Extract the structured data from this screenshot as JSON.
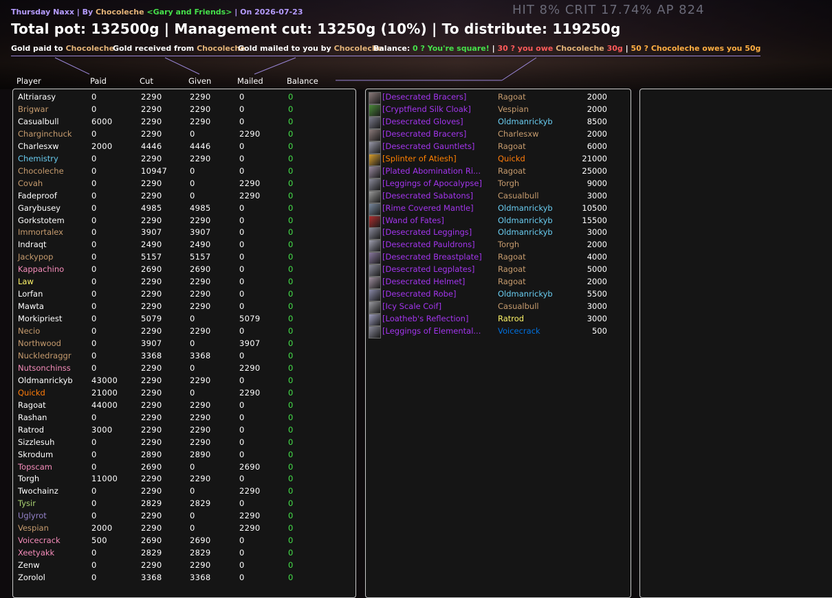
{
  "header": {
    "subtitle": {
      "event": "Thursday Naxx",
      "sep1": " | By ",
      "author": "Chocoleche",
      "guild": "<Gary and Friends>",
      "sep2": " | On ",
      "date": "2026-07-23"
    },
    "title": "Total pot: 132500g | Management cut: 13250g (10%) | To distribute: 119250g",
    "ghost_hud": "HIT 8% CRIT 17.74%  AP 824"
  },
  "legend": {
    "paid": {
      "label": "Gold paid to ",
      "who": "Chocoleche"
    },
    "received": {
      "label": "Gold received from ",
      "who": "Chocoleche"
    },
    "mailed": {
      "label": "Gold mailed to you by ",
      "who": "Chocoleche"
    },
    "balance": {
      "label": "Balance: ",
      "square": "0 ? You're square!",
      "sep": "  |  ",
      "owe_a": "30 ? you owe ",
      "owe_who": "Chocoleche",
      "owe_b": " 30g",
      "owes_a": "50 ? ",
      "owes_who": "Chocoleche",
      "owes_b": " owes you 50g"
    }
  },
  "columns": {
    "player": "Player",
    "paid": "Paid",
    "cut": "Cut",
    "given": "Given",
    "mailed": "Mailed",
    "balance": "Balance"
  },
  "colors": {
    "warrior": "#c79c6e",
    "paladin": "#f58cba",
    "mage": "#69ccf0",
    "white": "#ffffff",
    "warlock": "#9482c9",
    "hunter": "#abd473",
    "rogue": "#fff569",
    "druid": "#ff7d0a",
    "shaman": "#0070de",
    "epic": "#a335ee",
    "legendary": "#ff8000",
    "balance_zero": "#45e04a"
  },
  "players": [
    {
      "name": "Altriarasy",
      "color": "#ffffff",
      "paid": "0",
      "cut": "2290",
      "given": "2290",
      "mailed": "0",
      "balance": "0"
    },
    {
      "name": "Brigwar",
      "color": "#c79c6e",
      "paid": "0",
      "cut": "2290",
      "given": "2290",
      "mailed": "0",
      "balance": "0"
    },
    {
      "name": "Casualbull",
      "color": "#ffffff",
      "paid": "6000",
      "cut": "2290",
      "given": "2290",
      "mailed": "0",
      "balance": "0"
    },
    {
      "name": "Charginchuck",
      "color": "#c79c6e",
      "paid": "0",
      "cut": "2290",
      "given": "0",
      "mailed": "2290",
      "balance": "0"
    },
    {
      "name": "Charlesxw",
      "color": "#ffffff",
      "paid": "2000",
      "cut": "4446",
      "given": "4446",
      "mailed": "0",
      "balance": "0"
    },
    {
      "name": "Chemistry",
      "color": "#69ccf0",
      "paid": "0",
      "cut": "2290",
      "given": "2290",
      "mailed": "0",
      "balance": "0"
    },
    {
      "name": "Chocoleche",
      "color": "#c79c6e",
      "paid": "0",
      "cut": "10947",
      "given": "0",
      "mailed": "0",
      "balance": "0"
    },
    {
      "name": "Covah",
      "color": "#c79c6e",
      "paid": "0",
      "cut": "2290",
      "given": "0",
      "mailed": "2290",
      "balance": "0"
    },
    {
      "name": "Fadeproof",
      "color": "#ffffff",
      "paid": "0",
      "cut": "2290",
      "given": "0",
      "mailed": "2290",
      "balance": "0"
    },
    {
      "name": "Garybusey",
      "color": "#ffffff",
      "paid": "0",
      "cut": "4985",
      "given": "4985",
      "mailed": "0",
      "balance": "0"
    },
    {
      "name": "Gorkstotem",
      "color": "#ffffff",
      "paid": "0",
      "cut": "2290",
      "given": "2290",
      "mailed": "0",
      "balance": "0"
    },
    {
      "name": "Immortalex",
      "color": "#c79c6e",
      "paid": "0",
      "cut": "3907",
      "given": "3907",
      "mailed": "0",
      "balance": "0"
    },
    {
      "name": "Indraqt",
      "color": "#ffffff",
      "paid": "0",
      "cut": "2490",
      "given": "2490",
      "mailed": "0",
      "balance": "0"
    },
    {
      "name": "Jackypop",
      "color": "#c79c6e",
      "paid": "0",
      "cut": "5157",
      "given": "5157",
      "mailed": "0",
      "balance": "0"
    },
    {
      "name": "Kappachino",
      "color": "#f58cba",
      "paid": "0",
      "cut": "2690",
      "given": "2690",
      "mailed": "0",
      "balance": "0"
    },
    {
      "name": "Law",
      "color": "#fff569",
      "paid": "0",
      "cut": "2290",
      "given": "2290",
      "mailed": "0",
      "balance": "0"
    },
    {
      "name": "Lorfan",
      "color": "#ffffff",
      "paid": "0",
      "cut": "2290",
      "given": "2290",
      "mailed": "0",
      "balance": "0"
    },
    {
      "name": "Mawta",
      "color": "#ffffff",
      "paid": "0",
      "cut": "2290",
      "given": "2290",
      "mailed": "0",
      "balance": "0"
    },
    {
      "name": "Morkipriest",
      "color": "#ffffff",
      "paid": "0",
      "cut": "5079",
      "given": "0",
      "mailed": "5079",
      "balance": "0"
    },
    {
      "name": "Necio",
      "color": "#c79c6e",
      "paid": "0",
      "cut": "2290",
      "given": "2290",
      "mailed": "0",
      "balance": "0"
    },
    {
      "name": "Northwood",
      "color": "#c79c6e",
      "paid": "0",
      "cut": "3907",
      "given": "0",
      "mailed": "3907",
      "balance": "0"
    },
    {
      "name": "Nuckledraggr",
      "color": "#c79c6e",
      "paid": "0",
      "cut": "3368",
      "given": "3368",
      "mailed": "0",
      "balance": "0"
    },
    {
      "name": "Nutsonchinss",
      "color": "#f58cba",
      "paid": "0",
      "cut": "2290",
      "given": "0",
      "mailed": "2290",
      "balance": "0"
    },
    {
      "name": "Oldmanrickyb",
      "color": "#ffffff",
      "paid": "43000",
      "cut": "2290",
      "given": "2290",
      "mailed": "0",
      "balance": "0"
    },
    {
      "name": "Quickd",
      "color": "#ff7d0a",
      "paid": "21000",
      "cut": "2290",
      "given": "0",
      "mailed": "2290",
      "balance": "0"
    },
    {
      "name": "Ragoat",
      "color": "#ffffff",
      "paid": "44000",
      "cut": "2290",
      "given": "2290",
      "mailed": "0",
      "balance": "0"
    },
    {
      "name": "Rashan",
      "color": "#ffffff",
      "paid": "0",
      "cut": "2290",
      "given": "2290",
      "mailed": "0",
      "balance": "0"
    },
    {
      "name": "Ratrod",
      "color": "#ffffff",
      "paid": "3000",
      "cut": "2290",
      "given": "2290",
      "mailed": "0",
      "balance": "0"
    },
    {
      "name": "Sizzlesuh",
      "color": "#ffffff",
      "paid": "0",
      "cut": "2290",
      "given": "2290",
      "mailed": "0",
      "balance": "0"
    },
    {
      "name": "Skrodum",
      "color": "#ffffff",
      "paid": "0",
      "cut": "2890",
      "given": "2890",
      "mailed": "0",
      "balance": "0"
    },
    {
      "name": "Topscam",
      "color": "#f58cba",
      "paid": "0",
      "cut": "2690",
      "given": "0",
      "mailed": "2690",
      "balance": "0"
    },
    {
      "name": "Torgh",
      "color": "#ffffff",
      "paid": "11000",
      "cut": "2290",
      "given": "2290",
      "mailed": "0",
      "balance": "0"
    },
    {
      "name": "Twochainz",
      "color": "#ffffff",
      "paid": "0",
      "cut": "2290",
      "given": "0",
      "mailed": "2290",
      "balance": "0"
    },
    {
      "name": "Tysir",
      "color": "#abd473",
      "paid": "0",
      "cut": "2829",
      "given": "2829",
      "mailed": "0",
      "balance": "0"
    },
    {
      "name": "Uglyrot",
      "color": "#9482c9",
      "paid": "0",
      "cut": "2290",
      "given": "0",
      "mailed": "2290",
      "balance": "0"
    },
    {
      "name": "Vespian",
      "color": "#c79c6e",
      "paid": "2000",
      "cut": "2290",
      "given": "0",
      "mailed": "2290",
      "balance": "0"
    },
    {
      "name": "Voicecrack",
      "color": "#f58cba",
      "paid": "500",
      "cut": "2690",
      "given": "2690",
      "mailed": "0",
      "balance": "0"
    },
    {
      "name": "Xeetyakk",
      "color": "#f58cba",
      "paid": "0",
      "cut": "2829",
      "given": "2829",
      "mailed": "0",
      "balance": "0"
    },
    {
      "name": "Zenw",
      "color": "#ffffff",
      "paid": "0",
      "cut": "2290",
      "given": "2290",
      "mailed": "0",
      "balance": "0"
    },
    {
      "name": "Zorolol",
      "color": "#ffffff",
      "paid": "0",
      "cut": "3368",
      "given": "3368",
      "mailed": "0",
      "balance": "0"
    }
  ],
  "loot": [
    {
      "item": "[Desecrated Bracers]",
      "quality": "epic",
      "icon": "bracers-icon",
      "buyer": "Ragoat",
      "buyer_color": "#c79c6e",
      "price": "2000"
    },
    {
      "item": "[Cryptfiend Silk Cloak]",
      "quality": "epic",
      "icon": "cloak-icon",
      "buyer": "Vespian",
      "buyer_color": "#c79c6e",
      "price": "2000"
    },
    {
      "item": "[Desecrated Gloves]",
      "quality": "epic",
      "icon": "gloves-icon",
      "buyer": "Oldmanrickyb",
      "buyer_color": "#69ccf0",
      "price": "8500"
    },
    {
      "item": "[Desecrated Bracers]",
      "quality": "epic",
      "icon": "bracers-icon",
      "buyer": "Charlesxw",
      "buyer_color": "#c79c6e",
      "price": "2000"
    },
    {
      "item": "[Desecrated Gauntlets]",
      "quality": "epic",
      "icon": "gauntlets-icon",
      "buyer": "Ragoat",
      "buyer_color": "#c79c6e",
      "price": "6000"
    },
    {
      "item": "[Splinter of Atiesh]",
      "quality": "legendary",
      "icon": "splinter-icon",
      "buyer": "Quickd",
      "buyer_color": "#ff7d0a",
      "price": "21000"
    },
    {
      "item": "[Plated Abomination Ri...",
      "quality": "epic",
      "icon": "ring-icon",
      "buyer": "Ragoat",
      "buyer_color": "#c79c6e",
      "price": "25000"
    },
    {
      "item": "[Leggings of Apocalypse]",
      "quality": "epic",
      "icon": "leggings-icon",
      "buyer": "Torgh",
      "buyer_color": "#c79c6e",
      "price": "9000"
    },
    {
      "item": "[Desecrated Sabatons]",
      "quality": "epic",
      "icon": "sabatons-icon",
      "buyer": "Casualbull",
      "buyer_color": "#c79c6e",
      "price": "3000"
    },
    {
      "item": "[Rime Covered Mantle]",
      "quality": "epic",
      "icon": "mantle-icon",
      "buyer": "Oldmanrickyb",
      "buyer_color": "#69ccf0",
      "price": "10500"
    },
    {
      "item": "[Wand of Fates]",
      "quality": "epic",
      "icon": "wand-icon",
      "buyer": "Oldmanrickyb",
      "buyer_color": "#69ccf0",
      "price": "15500"
    },
    {
      "item": "[Desecrated Leggings]",
      "quality": "epic",
      "icon": "leggings-icon",
      "buyer": "Oldmanrickyb",
      "buyer_color": "#69ccf0",
      "price": "3000"
    },
    {
      "item": "[Desecrated Pauldrons]",
      "quality": "epic",
      "icon": "pauldrons-icon",
      "buyer": "Torgh",
      "buyer_color": "#c79c6e",
      "price": "2000"
    },
    {
      "item": "[Desecrated Breastplate]",
      "quality": "epic",
      "icon": "breastplate-icon",
      "buyer": "Ragoat",
      "buyer_color": "#c79c6e",
      "price": "4000"
    },
    {
      "item": "[Desecrated Legplates]",
      "quality": "epic",
      "icon": "legplates-icon",
      "buyer": "Ragoat",
      "buyer_color": "#c79c6e",
      "price": "5000"
    },
    {
      "item": "[Desecrated Helmet]",
      "quality": "epic",
      "icon": "helmet-icon",
      "buyer": "Ragoat",
      "buyer_color": "#c79c6e",
      "price": "2000"
    },
    {
      "item": "[Desecrated Robe]",
      "quality": "epic",
      "icon": "robe-icon",
      "buyer": "Oldmanrickyb",
      "buyer_color": "#69ccf0",
      "price": "5500"
    },
    {
      "item": "[Icy Scale Coif]",
      "quality": "epic",
      "icon": "coif-icon",
      "buyer": "Casualbull",
      "buyer_color": "#c79c6e",
      "price": "3000"
    },
    {
      "item": "[Loatheb's Reflection]",
      "quality": "epic",
      "icon": "trinket-icon",
      "buyer": "Ratrod",
      "buyer_color": "#fff569",
      "price": "3000"
    },
    {
      "item": "[Leggings of Elemental...",
      "quality": "epic",
      "icon": "leggings-icon",
      "buyer": "Voicecrack",
      "buyer_color": "#0070de",
      "price": "500"
    }
  ]
}
